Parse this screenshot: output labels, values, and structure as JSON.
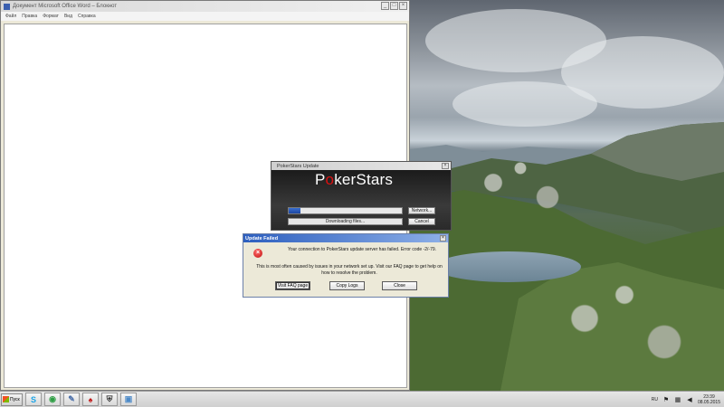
{
  "word_window": {
    "title": "Документ Microsoft Office Word – Блокнот",
    "menu": [
      "Файл",
      "Правка",
      "Формат",
      "Вид",
      "Справка"
    ],
    "controls": [
      "_",
      "□",
      "×"
    ]
  },
  "pokerstars_update": {
    "title": "PokerStars Update",
    "logo": {
      "pre": "P",
      "o": "o",
      "post": "kerStars"
    },
    "progress": 0.1,
    "status": "Downloading files...",
    "network_button": "Network...",
    "cancel_button": "Cancel",
    "close_glyph": "×"
  },
  "update_failed": {
    "title": "Update Failed",
    "close_glyph": "×",
    "error_glyph": "×",
    "message1": "Your connection to PokerStars update server has failed. Error code -2/-79.",
    "message2": "This is most often caused by issues in your network set up. Visit our FAQ page to get help on how to resolve the problem.",
    "buttons": [
      "Visit FAQ page",
      "Copy Logs",
      "Close"
    ]
  },
  "taskbar": {
    "start_label": "Пуск",
    "apps": [
      {
        "name": "skype",
        "glyph": "S",
        "color": "#1aa3e6"
      },
      {
        "name": "chrome",
        "glyph": "◉",
        "color": "#2e9e44"
      },
      {
        "name": "app3",
        "glyph": "✎",
        "color": "#4a6ea8"
      },
      {
        "name": "pokerstars",
        "glyph": "♠",
        "color": "#c01818"
      },
      {
        "name": "shield",
        "glyph": "⛨",
        "color": "#333333"
      },
      {
        "name": "app6",
        "glyph": "▣",
        "color": "#4d8ac8"
      }
    ],
    "language": "RU",
    "time": "23:39",
    "date": "08.05.2015"
  }
}
